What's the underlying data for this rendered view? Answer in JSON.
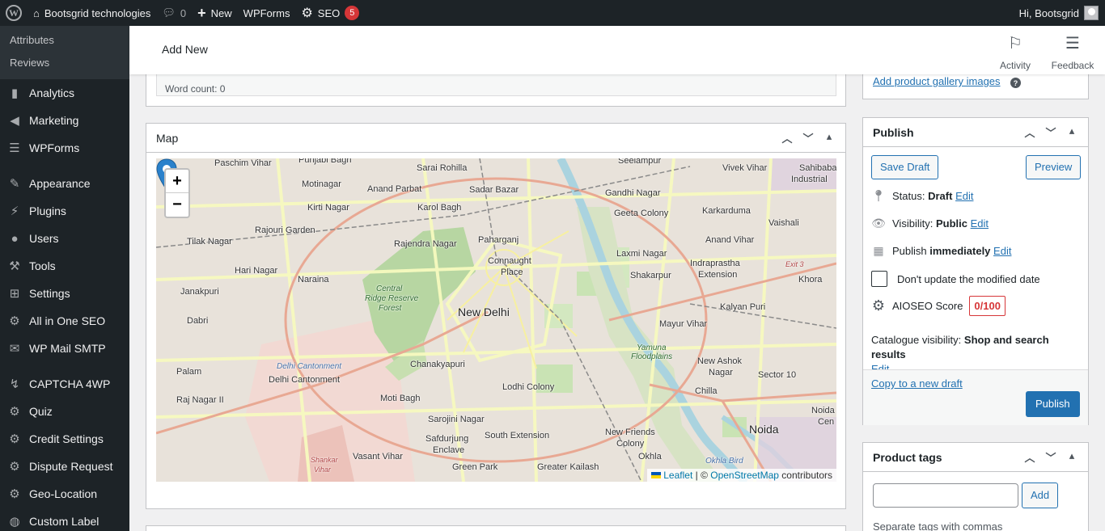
{
  "adminbar": {
    "site_name": "Bootsgrid technologies",
    "comments_count": "0",
    "new_label": "New",
    "wpforms_label": "WPForms",
    "seo_label": "SEO",
    "seo_badge": "5",
    "greeting": "Hi, Bootsgrid"
  },
  "sidebar": {
    "submenu": [
      "Attributes",
      "Reviews"
    ],
    "items": [
      {
        "label": "Analytics",
        "icon": "bar-chart-icon"
      },
      {
        "label": "Marketing",
        "icon": "megaphone-icon"
      },
      {
        "label": "WPForms",
        "icon": "form-icon"
      },
      {
        "label": "Appearance",
        "icon": "paintbrush-icon"
      },
      {
        "label": "Plugins",
        "icon": "plug-icon"
      },
      {
        "label": "Users",
        "icon": "user-icon"
      },
      {
        "label": "Tools",
        "icon": "wrench-icon"
      },
      {
        "label": "Settings",
        "icon": "sliders-icon"
      },
      {
        "label": "All in One SEO",
        "icon": "seo-gear-icon"
      },
      {
        "label": "WP Mail SMTP",
        "icon": "mail-icon"
      },
      {
        "label": "CAPTCHA 4WP",
        "icon": "captcha-icon"
      },
      {
        "label": "Quiz",
        "icon": "gear-icon"
      },
      {
        "label": "Credit Settings",
        "icon": "gear-icon"
      },
      {
        "label": "Dispute Request",
        "icon": "gear-icon"
      },
      {
        "label": "Geo-Location",
        "icon": "gear-icon"
      },
      {
        "label": "Custom Label",
        "icon": "globe-icon"
      }
    ]
  },
  "header": {
    "title": "Add New",
    "activity_label": "Activity",
    "feedback_label": "Feedback"
  },
  "editor": {
    "word_count": "Word count: 0"
  },
  "map_box": {
    "title": "Map",
    "zoom_in": "+",
    "zoom_out": "−",
    "attribution_leaflet": "Leaflet",
    "attribution_sep": " | © ",
    "attribution_osm": "OpenStreetMap",
    "attribution_tail": " contributors",
    "labels": {
      "paschim_vihar": "Paschim Vihar",
      "punjabi_bagh": "Punjabi Bagh",
      "sarai_rohilla": "Sarai Rohilla",
      "seelampur": "Seelampur",
      "vivek_vihar": "Vivek Vihar",
      "sahibabad": "Sahibaba",
      "sahibabad2": "Industrial",
      "motinagar": "Motinagar",
      "anand_parbat": "Anand Parbat",
      "sadar_bazar": "Sadar Bazar",
      "gandhi_nagar": "Gandhi Nagar",
      "kirti_nagar": "Kirti Nagar",
      "karol_bagh": "Karol Bagh",
      "geeta_colony": "Geeta Colony",
      "karkarduma": "Karkarduma",
      "vaishali": "Vaishali",
      "rajouri_garden": "Rajouri Garden",
      "tilak_nagar": "Tilak Nagar",
      "rajendra_nagar": "Rajendra Nagar",
      "paharganj": "Paharganj",
      "anand_vihar": "Anand Vihar",
      "hari_nagar": "Hari Nagar",
      "connaught": "Connaught",
      "place": "Place",
      "laxmi_nagar": "Laxmi Nagar",
      "indraprastha": "Indraprastha",
      "extension": "Extension",
      "exit3": "Exit 3",
      "naraina": "Naraina",
      "shakarpur": "Shakarpur",
      "khora": "Khora",
      "janakpuri": "Janakpuri",
      "central_ridge": "Central",
      "central_ridge2": "Ridge Reserve",
      "central_ridge3": "Forest",
      "new_delhi": "New Delhi",
      "kalyan_puri": "Kalyan Puri",
      "dabri": "Dabri",
      "mayur_vihar": "Mayur Vihar",
      "yamuna": "Yamuna",
      "floodplains": "Floodplains",
      "delhi_cantonment_area": "Delhi Cantonment",
      "chanakyapuri": "Chanakyapuri",
      "new_ashok": "New Ashok",
      "nagar": "Nagar",
      "palam": "Palam",
      "delhi_cantonment": "Delhi Cantonment",
      "sector10": "Sector 10",
      "lodhi_colony": "Lodhi Colony",
      "chilla": "Chilla",
      "raj_nagar": "Raj Nagar II",
      "moti_bagh": "Moti Bagh",
      "noida_short": "Noida",
      "noida_cen": "Cen",
      "sarojini_nagar": "Sarojini Nagar",
      "noida": "Noida",
      "safdurjung": "Safdurjung",
      "enclave": "Enclave",
      "south_extension": "South Extension",
      "new_friends": "New Friends",
      "colony": "Colony",
      "shankar": "Shankar",
      "vihar": "Vihar",
      "vasant_vihar": "Vasant Vihar",
      "okhla": "Okhla",
      "okhla_bird": "Okhla Bird",
      "green_park": "Green Park",
      "greater_kailash": "Greater Kailash"
    }
  },
  "gallery": {
    "link": "Add product gallery images",
    "help": "?"
  },
  "publish": {
    "title": "Publish",
    "save_draft": "Save Draft",
    "preview": "Preview",
    "status_label": "Status:",
    "status_value": "Draft",
    "visibility_label": "Visibility:",
    "visibility_value": "Public",
    "publish_label": "Publish",
    "publish_value": "immediately",
    "edit": "Edit",
    "dont_update": "Don't update the modified date",
    "aioseo_label": "AIOSEO Score",
    "aioseo_score": "0/100",
    "catalogue_label": "Catalogue visibility:",
    "catalogue_value": "Shop and search results",
    "copy_draft": "Copy to a new draft",
    "publish_button": "Publish"
  },
  "tags": {
    "title": "Product tags",
    "input_placeholder": "",
    "add_button": "Add",
    "note": "Separate tags with commas"
  },
  "colors": {
    "accent": "#2271b1",
    "admin_bg": "#1d2327",
    "danger": "#d63638"
  }
}
